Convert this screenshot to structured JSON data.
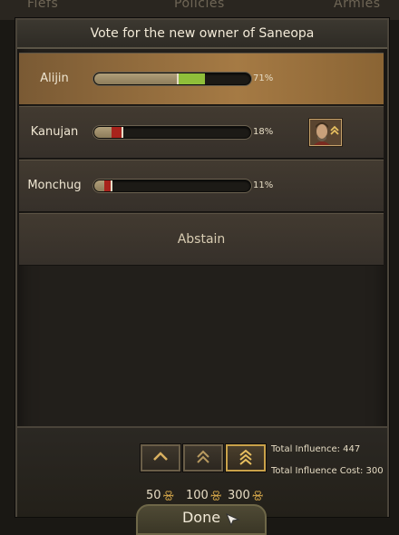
{
  "background_tabs": [
    "Fiefs",
    "Policies",
    "Armies"
  ],
  "title": "Vote for the new owner of Saneopa",
  "candidates": [
    {
      "name": "Alijin",
      "percent_label": "71%",
      "share": 0.71,
      "selected": true,
      "highlight_color": "#8fbf3a"
    },
    {
      "name": "Kanujan",
      "percent_label": "18%",
      "share": 0.18,
      "selected": false,
      "highlight_color": "#a8231c",
      "has_avatar": true
    },
    {
      "name": "Monchug",
      "percent_label": "11%",
      "share": 0.11,
      "selected": false,
      "highlight_color": "#a8231c"
    }
  ],
  "abstain_label": "Abstain",
  "influence_options": [
    {
      "cost": "50",
      "icon": "single-chevron-icon"
    },
    {
      "cost": "100",
      "icon": "double-chevron-icon"
    },
    {
      "cost": "300",
      "icon": "triple-chevron-icon",
      "selected": true
    }
  ],
  "coin_glyph": "🝮",
  "total_influence_label": "Total Influence: 447",
  "total_influence_cost_label": "Total Influence Cost: 300",
  "done_label": "Done",
  "colors": {
    "accent_gold": "#c9a24a",
    "bar_base": "#b09f7a"
  }
}
